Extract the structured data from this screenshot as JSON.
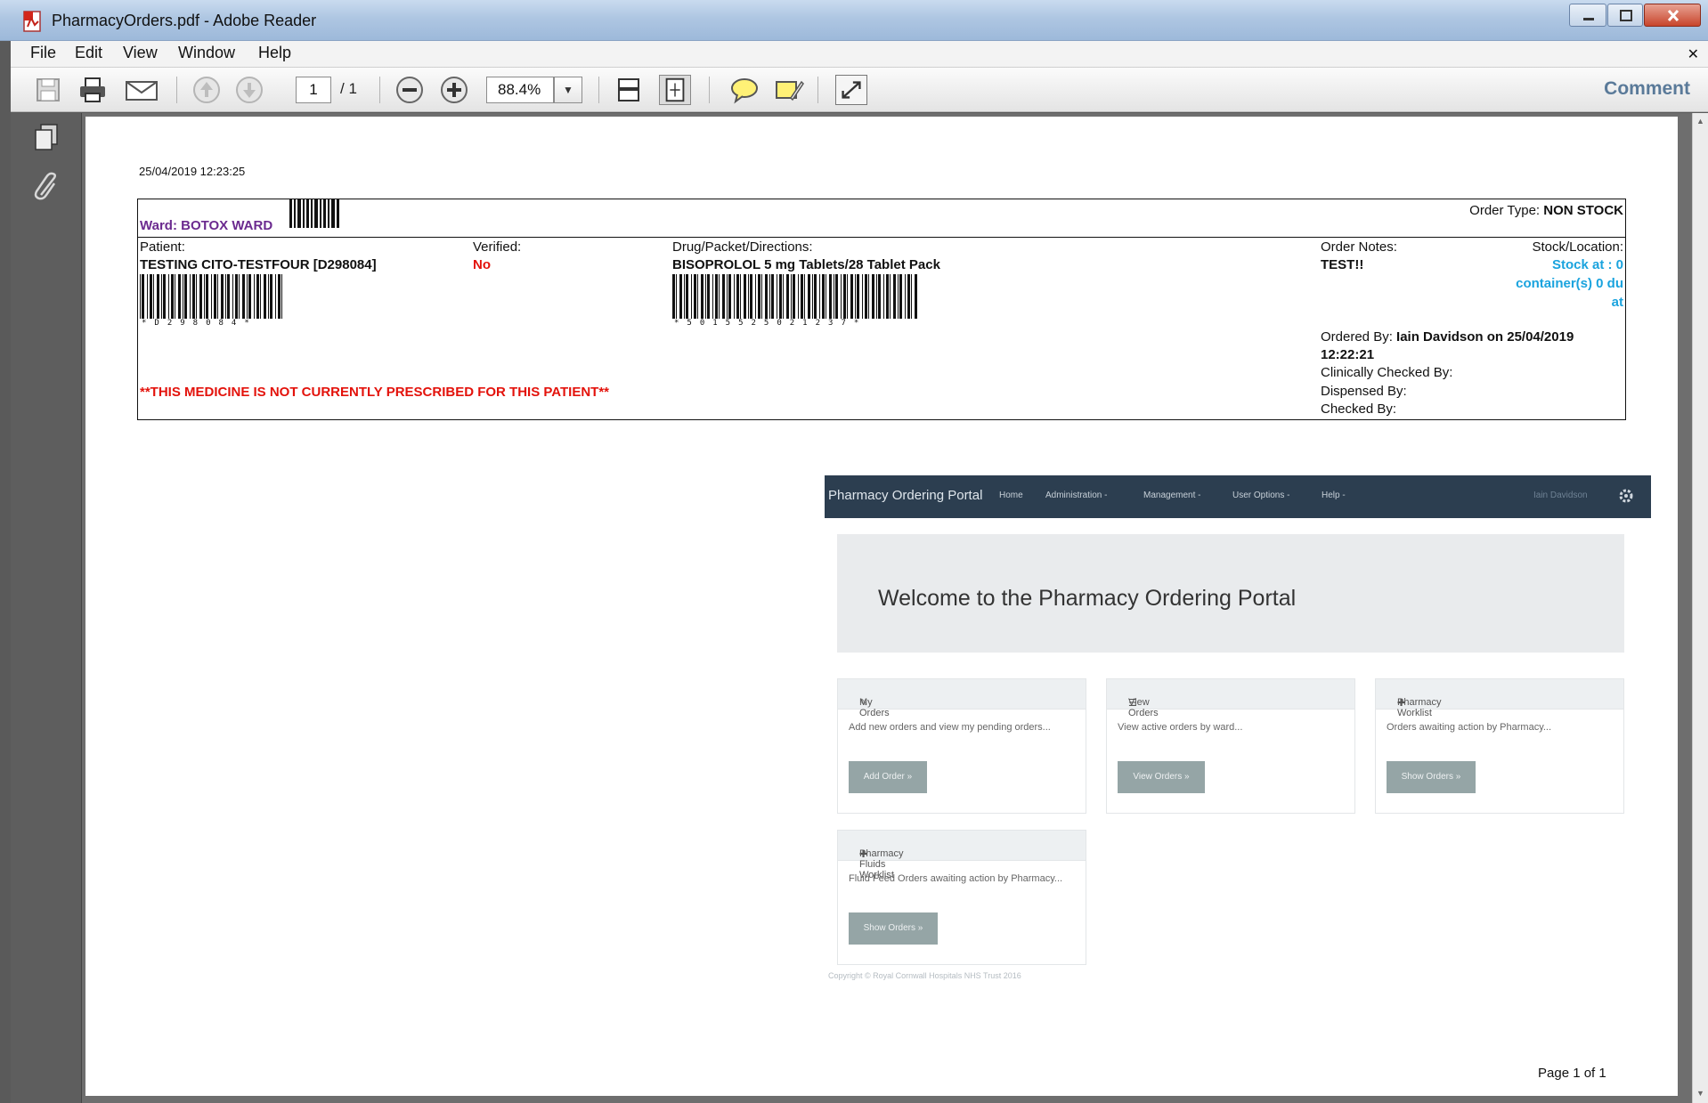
{
  "window": {
    "title": "PharmacyOrders.pdf - Adobe Reader"
  },
  "menu": [
    "File",
    "Edit",
    "View",
    "Window",
    "Help"
  ],
  "toolbar": {
    "page_current": "1",
    "page_total": "/ 1",
    "zoom": "88.4%",
    "comment_label": "Comment"
  },
  "report": {
    "timestamp": "25/04/2019 12:23:25",
    "ward": "Ward: BOTOX WARD",
    "order_type_label": "Order Type:",
    "order_type_value": "NON STOCK",
    "patient_label": "Patient:",
    "patient_value": "TESTING CITO-TESTFOUR [D298084]",
    "patient_barcode_digits": "*D298084*",
    "verified_label": "Verified:",
    "verified_value": "No",
    "drug_label": "Drug/Packet/Directions:",
    "drug_value": "BISOPROLOL 5 mg Tablets/28 Tablet Pack",
    "drug_barcode_digits": "*5015525021237*",
    "notes_label": "Order Notes:",
    "notes_value": "TEST!!",
    "stock_label": "Stock/Location:",
    "stock_line1": "Stock at : 0",
    "stock_line2": "container(s) 0 du",
    "stock_line3": "at",
    "ordered_by_label": "Ordered By:",
    "ordered_by_value": "Iain Davidson on 25/04/2019",
    "ordered_time": "12:22:21",
    "clinically_checked_label": "Clinically Checked  By:",
    "dispensed_label": "Dispensed By:",
    "checked_label": "Checked By:",
    "warning": "**THIS MEDICINE IS NOT CURRENTLY PRESCRIBED FOR THIS PATIENT**"
  },
  "portal": {
    "brand": "Pharmacy Ordering Portal",
    "nav_links": [
      "Home",
      "Administration -",
      "Management -",
      "User Options -",
      "Help -"
    ],
    "user": "Iain Davidson",
    "welcome": "Welcome to the Pharmacy Ordering Portal",
    "panels": [
      {
        "heading": "My Orders",
        "body": "Add new orders and view my pending orders...",
        "button": "Add Order »"
      },
      {
        "heading": "View Orders",
        "body": "View active orders by ward...",
        "button": "View Orders »"
      },
      {
        "heading": "Pharmacy Worklist",
        "body": "Orders awaiting action by Pharmacy...",
        "button": "Show Orders »"
      },
      {
        "heading": "Pharmacy Fluids Worklist",
        "body": "Fluid Feed Orders awaiting action by Pharmacy...",
        "button": "Show Orders »"
      }
    ],
    "footer": "Copyright © Royal Cornwall Hospitals NHS Trust 2016"
  },
  "page_footer": "Page 1 of 1",
  "colors": {
    "ward": "#6b2a8f",
    "warning": "#e3120b",
    "stock": "#1aa3de",
    "portal_nav": "#2c3e50",
    "comment": "#5a7a99"
  }
}
